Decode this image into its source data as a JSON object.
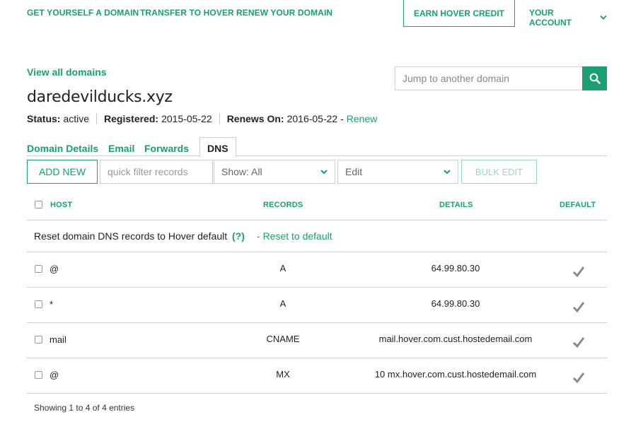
{
  "nav": {
    "links": [
      "GET YOURSELF A DOMAIN",
      "TRANSFER TO HOVER",
      "RENEW YOUR DOMAIN"
    ],
    "credit_button": "EARN HOVER CREDIT",
    "account": "YOUR ACCOUNT"
  },
  "view_all": "View all domains",
  "domain": "daredevilducks.xyz",
  "search": {
    "placeholder": "Jump to another domain"
  },
  "status": {
    "status_label": "Status:",
    "status_value": "active",
    "registered_label": "Registered:",
    "registered_value": "2015-05-22",
    "renews_label": "Renews On:",
    "renews_value": "2016-05-22 -",
    "renew_link": "Renew"
  },
  "tabs": [
    "Domain Details",
    "Email",
    "Forwards",
    "DNS"
  ],
  "toolbar": {
    "add_new": "ADD NEW",
    "filter_placeholder": "quick filter records",
    "show_select": "Show: All",
    "edit_select": "Edit",
    "bulk_edit": "BULK EDIT"
  },
  "table": {
    "headers": {
      "host": "HOST",
      "records": "RECORDS",
      "details": "DETAILS",
      "default": "DEFAULT"
    },
    "reset_text": "Reset domain DNS records to Hover default",
    "reset_help": "(?)",
    "reset_dash": "- ",
    "reset_link": "Reset to default",
    "rows": [
      {
        "host": "@",
        "record": "A",
        "details": "64.99.80.30"
      },
      {
        "host": "*",
        "record": "A",
        "details": "64.99.80.30"
      },
      {
        "host": "mail",
        "record": "CNAME",
        "details": "mail.hover.com.cust.hostedemail.com"
      },
      {
        "host": "@",
        "record": "MX",
        "details": "10 mx.hover.com.cust.hostedemail.com"
      }
    ]
  },
  "footer": "Showing 1 to 4 of 4 entries",
  "colors": {
    "accent": "#1a9e72",
    "border": "#cfcfcf",
    "check": "#8a8a8a"
  }
}
